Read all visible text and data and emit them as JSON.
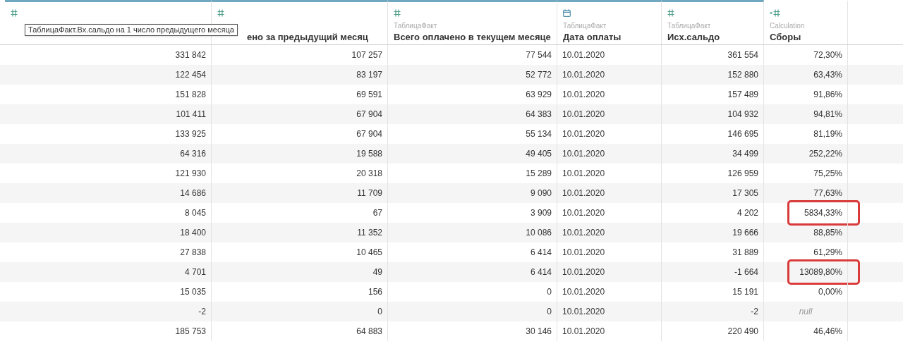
{
  "columns": [
    {
      "kind": "number",
      "accent": true
    },
    {
      "kind": "number",
      "title": "ено за предыдущий месяц",
      "title_cut": true,
      "accent": true
    },
    {
      "kind": "number",
      "source": "ТаблицаФакт",
      "title": "Всего оплачено в текущем месяце",
      "accent": true
    },
    {
      "kind": "date",
      "source": "ТаблицаФакт",
      "title": "Дата оплаты",
      "accent": true
    },
    {
      "kind": "number",
      "source": "ТаблицаФакт",
      "title": "Исх.сальдо",
      "accent": true
    },
    {
      "kind": "calc",
      "source": "Calculation",
      "title": "Сборы",
      "accent": false
    }
  ],
  "tooltip": "ТаблицаФакт.Вх.сальдо на   1 число предыдущего месяца",
  "rows": [
    {
      "cells": [
        "331 842",
        "107 257",
        "77 544",
        "10.01.2020",
        "361 554",
        "72,30%"
      ],
      "highlighted": false,
      "is_null": false
    },
    {
      "cells": [
        "122 454",
        "83 197",
        "52 772",
        "10.01.2020",
        "152 880",
        "63,43%"
      ],
      "highlighted": false,
      "is_null": false
    },
    {
      "cells": [
        "151 828",
        "69 591",
        "63 929",
        "10.01.2020",
        "157 489",
        "91,86%"
      ],
      "highlighted": false,
      "is_null": false
    },
    {
      "cells": [
        "101 411",
        "67 904",
        "64 383",
        "10.01.2020",
        "104 932",
        "94,81%"
      ],
      "highlighted": false,
      "is_null": false
    },
    {
      "cells": [
        "133 925",
        "67 904",
        "55 134",
        "10.01.2020",
        "146 695",
        "81,19%"
      ],
      "highlighted": false,
      "is_null": false
    },
    {
      "cells": [
        "64 316",
        "19 588",
        "49 405",
        "10.01.2020",
        "34 499",
        "252,22%"
      ],
      "highlighted": false,
      "is_null": false
    },
    {
      "cells": [
        "121 930",
        "20 318",
        "15 289",
        "10.01.2020",
        "126 959",
        "75,25%"
      ],
      "highlighted": false,
      "is_null": false
    },
    {
      "cells": [
        "14 686",
        "11 709",
        "9 090",
        "10.01.2020",
        "17 305",
        "77,63%"
      ],
      "highlighted": false,
      "is_null": false
    },
    {
      "cells": [
        "8 045",
        "67",
        "3 909",
        "10.01.2020",
        "4 202",
        "5834,33%"
      ],
      "highlighted": true,
      "is_null": false
    },
    {
      "cells": [
        "18 400",
        "11 352",
        "10 086",
        "10.01.2020",
        "19 666",
        "88,85%"
      ],
      "highlighted": false,
      "is_null": false
    },
    {
      "cells": [
        "27 838",
        "10 465",
        "6 414",
        "10.01.2020",
        "31 889",
        "61,29%"
      ],
      "highlighted": false,
      "is_null": false
    },
    {
      "cells": [
        "4 701",
        "49",
        "6 414",
        "10.01.2020",
        "-1 664",
        "13089,80%"
      ],
      "highlighted": true,
      "is_null": false
    },
    {
      "cells": [
        "15 035",
        "156",
        "0",
        "10.01.2020",
        "15 191",
        "0,00%"
      ],
      "highlighted": false,
      "is_null": false
    },
    {
      "cells": [
        "-2",
        "0",
        "0",
        "10.01.2020",
        "-2",
        "null"
      ],
      "highlighted": false,
      "is_null": true
    },
    {
      "cells": [
        "185 753",
        "64 883",
        "30 146",
        "10.01.2020",
        "220 490",
        "46,46%"
      ],
      "highlighted": false,
      "is_null": false
    }
  ]
}
